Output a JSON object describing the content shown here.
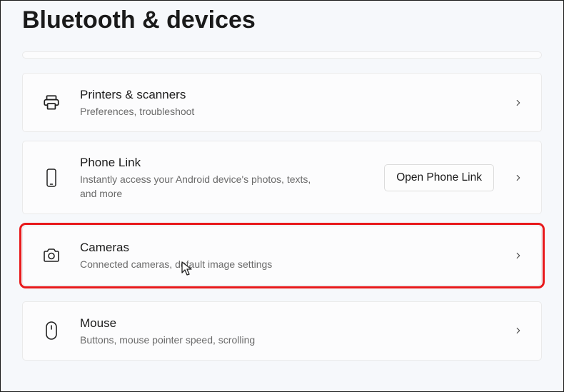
{
  "page": {
    "title": "Bluetooth & devices"
  },
  "items": {
    "printers": {
      "title": "Printers & scanners",
      "subtitle": "Preferences, troubleshoot"
    },
    "phonelink": {
      "title": "Phone Link",
      "subtitle": "Instantly access your Android device's photos, texts, and more",
      "button": "Open Phone Link"
    },
    "cameras": {
      "title": "Cameras",
      "subtitle": "Connected cameras, default image settings"
    },
    "mouse": {
      "title": "Mouse",
      "subtitle": "Buttons, mouse pointer speed, scrolling"
    }
  }
}
